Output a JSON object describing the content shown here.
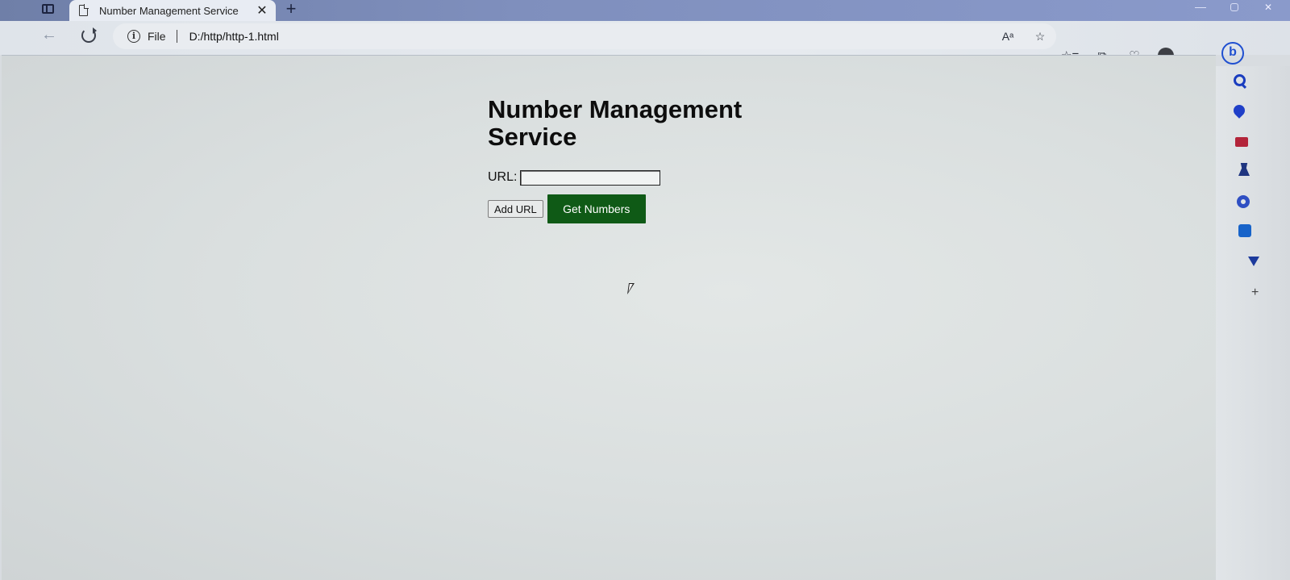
{
  "browser": {
    "tab": {
      "title": "Number Management Service",
      "close_glyph": "✕"
    },
    "new_tab_glyph": "+",
    "address": {
      "scheme_label": "File",
      "url": "D:/http/http-1.html"
    },
    "address_tools": {
      "read_aloud_glyph": "Aᵃ",
      "favorite_glyph": "☆"
    },
    "toolbar_glyphs": {
      "favorites": "☆≡",
      "collections": "⧉",
      "performance": "♡",
      "more": "···"
    },
    "sidebar_add_glyph": "+",
    "icons": [
      "back-arrow-icon",
      "refresh-icon",
      "info-icon",
      "read-aloud-icon",
      "favorite-star-icon",
      "favorites-icon",
      "collections-icon",
      "performance-icon",
      "profile-avatar",
      "more-icon",
      "bing-chat-icon",
      "search-icon",
      "shopping-tag-icon",
      "tools-bag-icon",
      "games-icon",
      "office-icon",
      "outlook-icon",
      "drop-icon"
    ]
  },
  "page": {
    "title": "Number Management Service",
    "url_label": "URL:",
    "url_input_value": "",
    "add_url_label": "Add URL",
    "get_numbers_label": "Get Numbers"
  },
  "colors": {
    "get_numbers_button": "#0f5a16",
    "bing_accent": "#1f4fd0"
  }
}
